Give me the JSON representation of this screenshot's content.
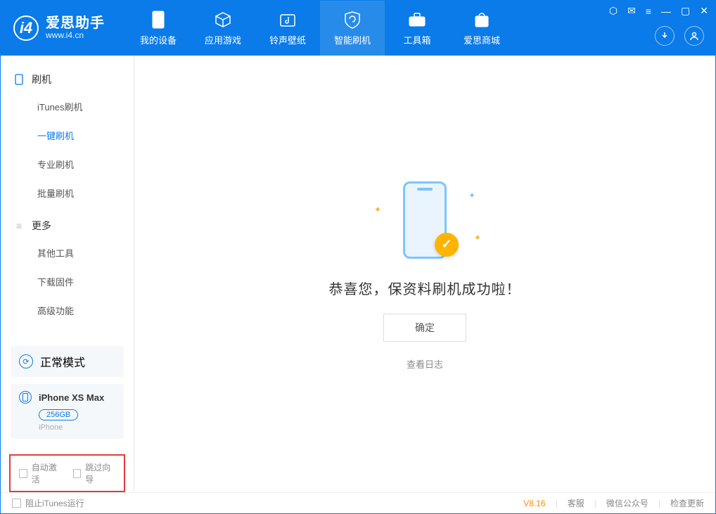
{
  "app": {
    "name_cn": "爱思助手",
    "name_en": "www.i4.cn"
  },
  "nav": {
    "device": "我的设备",
    "apps": "应用游戏",
    "ringtone": "铃声壁纸",
    "flash": "智能刷机",
    "toolbox": "工具箱",
    "store": "爱思商城"
  },
  "sidebar": {
    "flash_header": "刷机",
    "items_flash": {
      "itunes": "iTunes刷机",
      "onekey": "一键刷机",
      "pro": "专业刷机",
      "batch": "批量刷机"
    },
    "more_header": "更多",
    "items_more": {
      "other": "其他工具",
      "firmware": "下载固件",
      "advanced": "高级功能"
    }
  },
  "device": {
    "mode": "正常模式",
    "name": "iPhone XS Max",
    "storage": "256GB",
    "type": "iPhone"
  },
  "options": {
    "auto_activate": "自动激活",
    "skip_guide": "跳过向导"
  },
  "result": {
    "message": "恭喜您，保资料刷机成功啦！",
    "ok": "确定",
    "view_log": "查看日志"
  },
  "footer": {
    "block_itunes": "阻止iTunes运行",
    "version": "V8.16",
    "support": "客服",
    "wechat": "微信公众号",
    "update": "检查更新"
  }
}
